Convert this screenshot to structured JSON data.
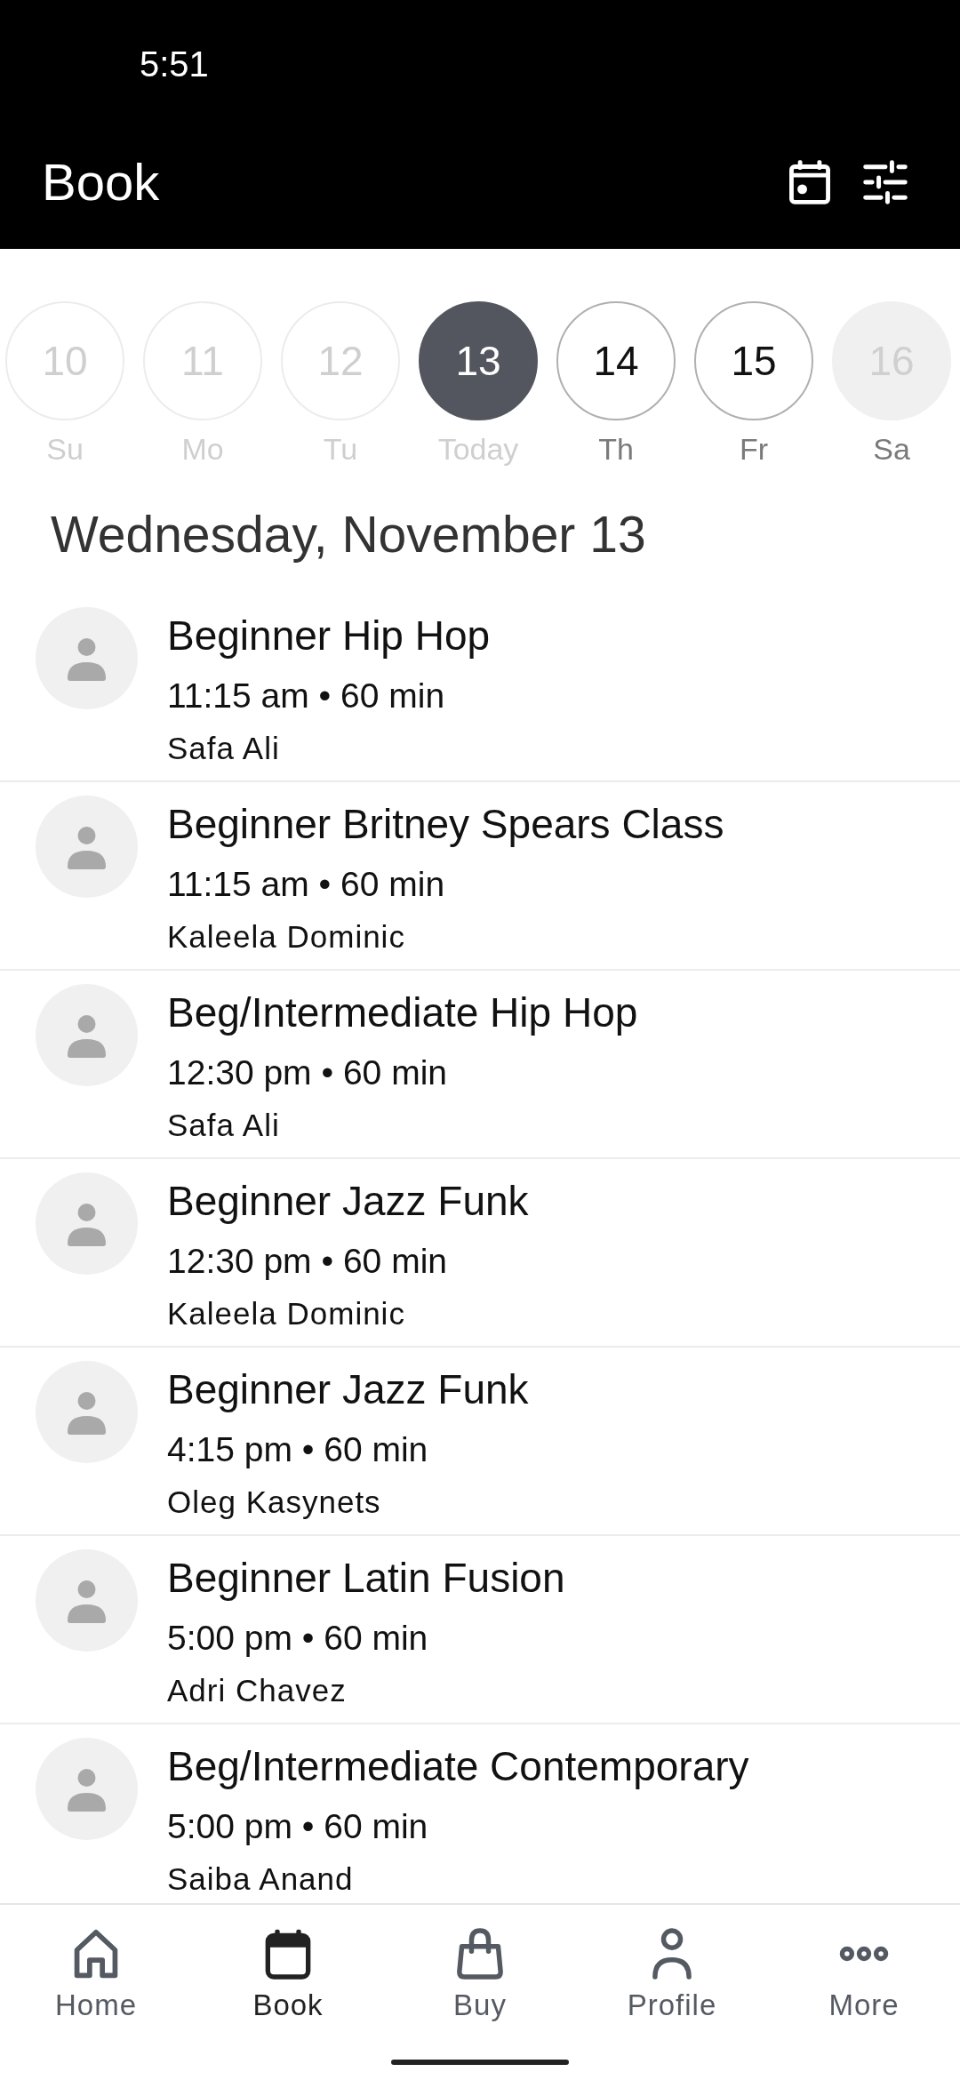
{
  "status_bar": {
    "time": "5:51"
  },
  "header": {
    "title": "Book"
  },
  "days": [
    {
      "number": "10",
      "weekday": "Su",
      "kind": "past",
      "selected": false
    },
    {
      "number": "11",
      "weekday": "Mo",
      "kind": "past",
      "selected": false
    },
    {
      "number": "12",
      "weekday": "Tu",
      "kind": "past",
      "selected": false
    },
    {
      "number": "13",
      "weekday": "Today",
      "kind": "today",
      "selected": true
    },
    {
      "number": "14",
      "weekday": "Th",
      "kind": "open",
      "selected": false
    },
    {
      "number": "15",
      "weekday": "Fr",
      "kind": "open",
      "selected": false
    },
    {
      "number": "16",
      "weekday": "Sa",
      "kind": "closed",
      "selected": false
    }
  ],
  "date_heading": "Wednesday, November 13",
  "classes": [
    {
      "title": "Beginner Hip Hop",
      "time": "11:15 am • 60 min",
      "instructor": "Safa Ali"
    },
    {
      "title": "Beginner Britney Spears Class",
      "time": "11:15 am • 60 min",
      "instructor": "Kaleela Dominic"
    },
    {
      "title": "Beg/Intermediate Hip Hop",
      "time": "12:30 pm • 60 min",
      "instructor": "Safa Ali"
    },
    {
      "title": "Beginner Jazz Funk",
      "time": "12:30 pm • 60 min",
      "instructor": "Kaleela Dominic"
    },
    {
      "title": "Beginner Jazz Funk",
      "time": "4:15 pm • 60 min",
      "instructor": "Oleg Kasynets"
    },
    {
      "title": "Beginner Latin Fusion",
      "time": "5:00 pm • 60 min",
      "instructor": "Adri Chavez"
    },
    {
      "title": "Beg/Intermediate Contemporary",
      "time": "5:00 pm • 60 min",
      "instructor": "Saiba Anand"
    }
  ],
  "bottom_nav": [
    {
      "label": "Home",
      "selected": false
    },
    {
      "label": "Book",
      "selected": true
    },
    {
      "label": "Buy",
      "selected": false
    },
    {
      "label": "Profile",
      "selected": false
    },
    {
      "label": "More",
      "selected": false
    }
  ]
}
